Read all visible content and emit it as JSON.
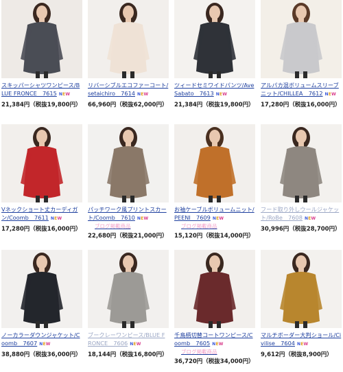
{
  "products": [
    {
      "title": "スキッパーシャツワンピース/BLUE FRONCE　7615",
      "new": true,
      "blog": "",
      "price": "21,384円（税抜19,800円）",
      "sold": false,
      "colors": {
        "bg": "#eeeae6",
        "main": "#4a4d55",
        "skin": "#e8c8b0",
        "hair": "#3a2820"
      }
    },
    {
      "title": "リバーシブルエコファーコート/setaichiro　7614",
      "new": true,
      "blog": "",
      "price": "66,960円（税抜62,000円）",
      "sold": false,
      "colors": {
        "bg": "#f2efec",
        "main": "#efe2d6",
        "skin": "#e8c8b0",
        "hair": "#3a2820"
      }
    },
    {
      "title": "ツィードセミワイドパンツ/Ave Sabato　7613",
      "new": true,
      "blog": "",
      "price": "21,384円（税抜19,800円）",
      "sold": false,
      "colors": {
        "bg": "#f4f2ef",
        "main": "#2f3238",
        "skin": "#e8c8b0",
        "hair": "#3a2820"
      }
    },
    {
      "title": "アルパカ混ボリュームスリーブニット/CHILLEA　7612",
      "new": true,
      "blog": "",
      "price": "17,280円（税抜16,000円）",
      "sold": false,
      "colors": {
        "bg": "#f3efe8",
        "main": "#c9c9cc",
        "skin": "#e8c8b0",
        "hair": "#5a3a28"
      }
    },
    {
      "title": "Vネックショート丈カーディガン/Coomb　7611",
      "new": true,
      "blog": "",
      "price": "17,280円（税抜16,000円）",
      "sold": false,
      "colors": {
        "bg": "#f2efec",
        "main": "#c2262a",
        "skin": "#e8c8b0",
        "hair": "#3a2820"
      }
    },
    {
      "title": "パッチワーク風プリントスカート/Coomb　7610",
      "new": true,
      "blog": "ブログ掲載商品",
      "price": "22,680円（税抜21,000円）",
      "sold": false,
      "colors": {
        "bg": "#f2f1ef",
        "main": "#8a7868",
        "skin": "#e8c8b0",
        "hair": "#3a2820"
      }
    },
    {
      "title": "お袖ケーブルボリュームニット/PEENI　7609",
      "new": true,
      "blog": "ブログ掲載商品",
      "price": "15,120円（税抜14,000円）",
      "sold": false,
      "colors": {
        "bg": "#f2efec",
        "main": "#c0702a",
        "skin": "#e8c8b0",
        "hair": "#4a3020"
      }
    },
    {
      "title": "フード取り外しウールジャケット/RoBe　7608",
      "new": true,
      "blog": "",
      "price": "30,996円（税抜28,700円）",
      "sold": true,
      "colors": {
        "bg": "#f3f1ee",
        "main": "#8e8780",
        "skin": "#e8c8b0",
        "hair": "#3a2820"
      }
    },
    {
      "title": "ノーカラーダウンジャケット/Coomb　7607",
      "new": true,
      "blog": "",
      "price": "38,880円（税抜36,000円）",
      "sold": false,
      "colors": {
        "bg": "#f2f0ee",
        "main": "#23262c",
        "skin": "#e8c8b0",
        "hair": "#3a2820"
      }
    },
    {
      "title": "ブークレーワンピース/BLUE FRONCE　7606",
      "new": true,
      "blog": "",
      "price": "18,144円（税抜16,800円）",
      "sold": true,
      "colors": {
        "bg": "#f2f0ee",
        "main": "#9c9a96",
        "skin": "#e8c8b0",
        "hair": "#3a2820"
      }
    },
    {
      "title": "千鳥柄切替コートワンピース/Coomb　7605",
      "new": true,
      "blog": "ブログ掲載商品",
      "price": "36,720円（税抜34,000円）",
      "sold": false,
      "colors": {
        "bg": "#f2efec",
        "main": "#6a2a2c",
        "skin": "#e8c8b0",
        "hair": "#3a2820"
      }
    },
    {
      "title": "マルチボーダー大判ショール/Civilise　7604",
      "new": true,
      "blog": "",
      "price": "9,612円（税抜8,900円）",
      "sold": false,
      "colors": {
        "bg": "#f3f1ee",
        "main": "#b8862e",
        "skin": "#e8c8b0",
        "hair": "#3a2820"
      }
    }
  ],
  "new_label": {
    "n": "N",
    "e": "E",
    "w": "W"
  }
}
